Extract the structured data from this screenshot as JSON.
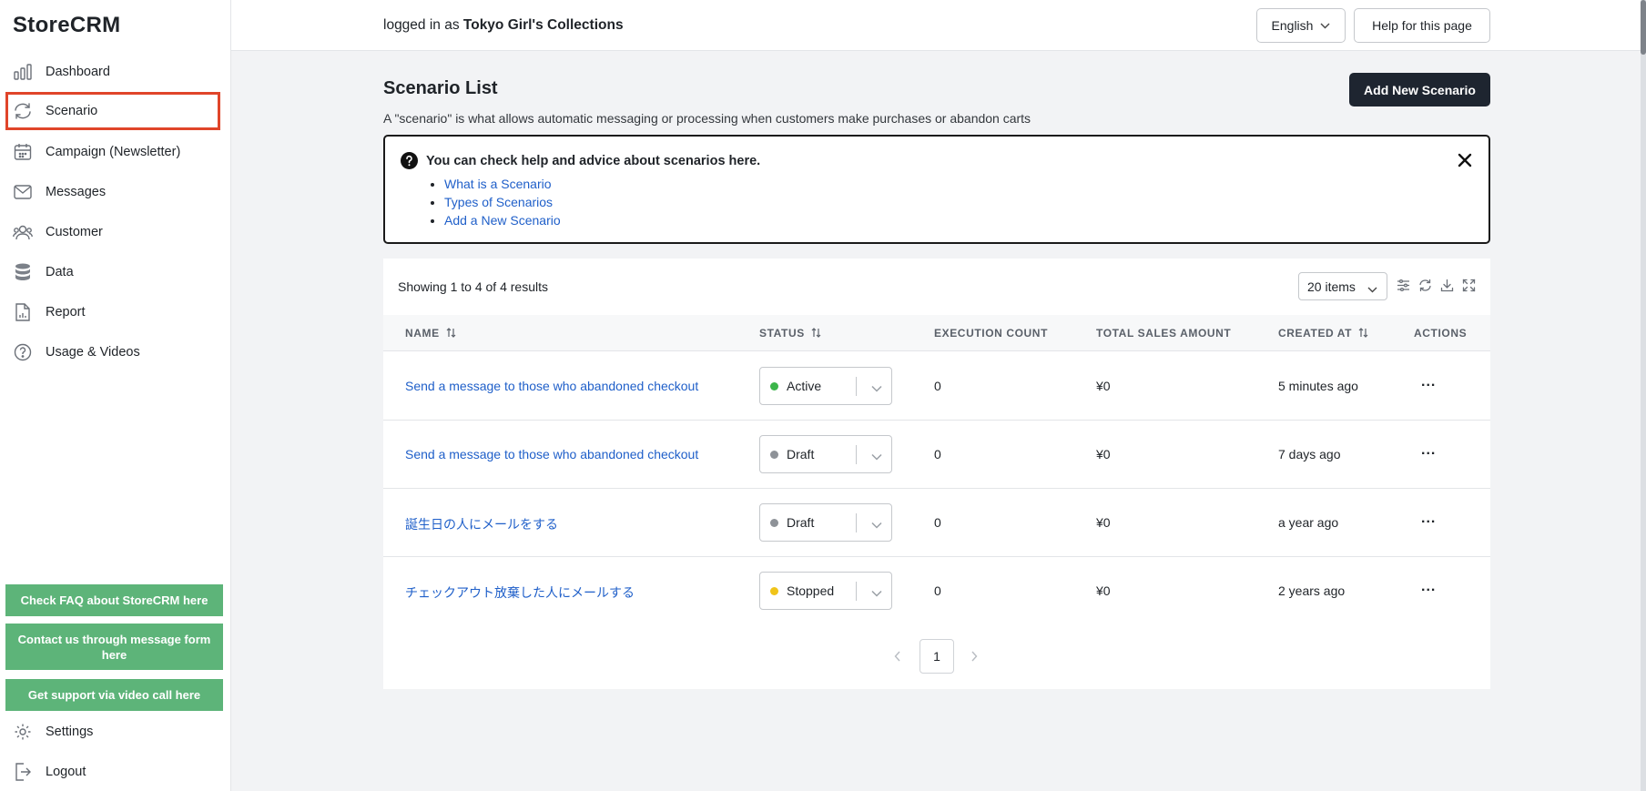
{
  "app": {
    "logo": "StoreCRM"
  },
  "sidebar": {
    "items": [
      {
        "label": "Dashboard",
        "icon": "bar-chart-icon"
      },
      {
        "label": "Scenario",
        "icon": "refresh-icon",
        "selected": true
      },
      {
        "label": "Campaign (Newsletter)",
        "icon": "calendar-icon"
      },
      {
        "label": "Messages",
        "icon": "mail-icon"
      },
      {
        "label": "Customer",
        "icon": "users-icon"
      },
      {
        "label": "Data",
        "icon": "database-icon"
      },
      {
        "label": "Report",
        "icon": "report-icon"
      },
      {
        "label": "Usage & Videos",
        "icon": "question-icon"
      }
    ],
    "support_buttons": [
      "Check FAQ about StoreCRM here",
      "Contact us through message form here",
      "Get support via video call here"
    ],
    "settings_label": "Settings",
    "logout_label": "Logout"
  },
  "header": {
    "logged_in_prefix": "logged in as",
    "store_name": "Tokyo Girl's Collections",
    "language": "English",
    "help_label": "Help for this page"
  },
  "main": {
    "title": "Scenario List",
    "subtitle": "A \"scenario\" is what allows automatic messaging or processing when customers make purchases or abandon carts",
    "add_button": "Add New Scenario",
    "help_box": {
      "title": "You can check help and advice about scenarios here.",
      "links": [
        "What is a Scenario",
        "Types of Scenarios",
        "Add a New Scenario"
      ]
    },
    "table": {
      "showing": "Showing 1 to 4 of 4 results",
      "page_size": "20 items",
      "columns": [
        "NAME",
        "STATUS",
        "EXECUTION COUNT",
        "TOTAL SALES AMOUNT",
        "CREATED AT",
        "ACTIONS"
      ],
      "rows": [
        {
          "name": "Send a message to those who abandoned checkout",
          "status": "Active",
          "status_color": "#3bb54a",
          "execution_count": "0",
          "total_sales": "¥0",
          "created_at": "5 minutes ago",
          "actions": "..."
        },
        {
          "name": "Send a message to those who abandoned checkout",
          "status": "Draft",
          "status_color": "#8e9298",
          "execution_count": "0",
          "total_sales": "¥0",
          "created_at": "7 days ago",
          "actions": "..."
        },
        {
          "name": "誕生日の人にメールをする",
          "status": "Draft",
          "status_color": "#8e9298",
          "execution_count": "0",
          "total_sales": "¥0",
          "created_at": "a year ago",
          "actions": "..."
        },
        {
          "name": "チェックアウト放棄した人にメールする",
          "status": "Stopped",
          "status_color": "#f0c419",
          "execution_count": "0",
          "total_sales": "¥0",
          "created_at": "2 years ago",
          "actions": "..."
        }
      ],
      "pagination": {
        "current_page": "1"
      }
    }
  },
  "colors": {
    "primary": "#1e2530",
    "link": "#1f5fc9",
    "support_green": "#5db479",
    "highlight": "#e0452a"
  }
}
